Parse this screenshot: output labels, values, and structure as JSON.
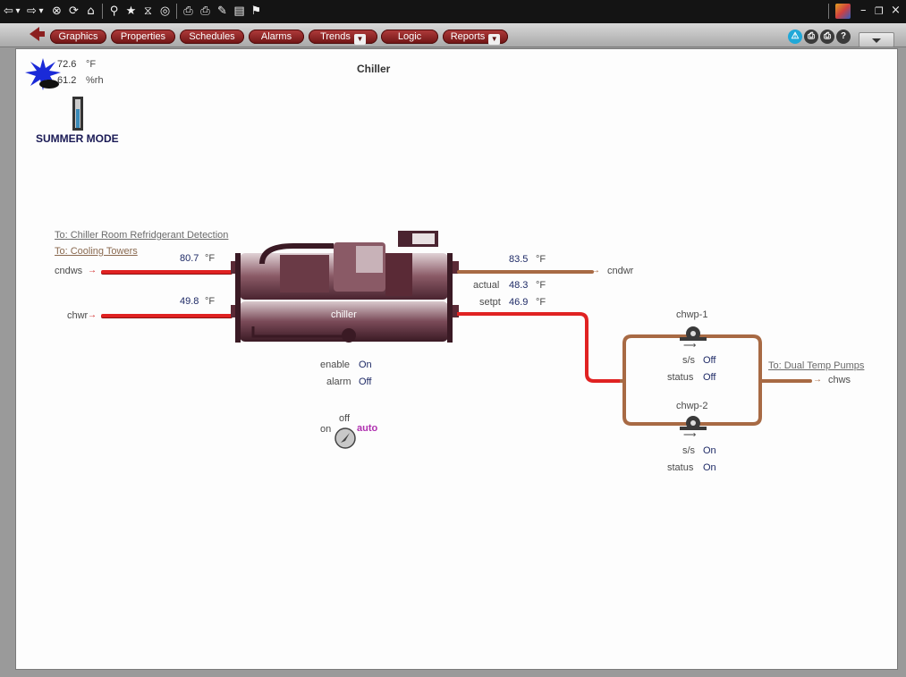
{
  "toolbar": {
    "icons": [
      "back-icon",
      "dropdown-icon",
      "forward-icon",
      "dropdown-icon",
      "stop-icon",
      "refresh-icon",
      "home-icon",
      "search-icon",
      "favorites-icon",
      "history-icon",
      "web-icon",
      "print-icon",
      "printer-icon",
      "edit-icon",
      "document-icon",
      "discuss-icon"
    ],
    "glyphs": [
      "⇦",
      "▾",
      "⇨",
      "▾",
      "⊗",
      "⟳",
      "⌂",
      "⚲",
      "★",
      "⧖",
      "◎",
      "⎙",
      "⎙",
      "✎",
      "▤",
      "⚑"
    ]
  },
  "window": {
    "minimize": "–",
    "restore": "❐",
    "close": "×"
  },
  "nav": {
    "tabs": [
      {
        "label": "Graphics",
        "dropdown": false
      },
      {
        "label": "Properties",
        "dropdown": false
      },
      {
        "label": "Schedules",
        "dropdown": false
      },
      {
        "label": "Alarms",
        "dropdown": false
      },
      {
        "label": "Trends",
        "dropdown": true
      },
      {
        "label": "Logic",
        "dropdown": false
      },
      {
        "label": "Reports",
        "dropdown": true
      }
    ],
    "right_buttons": [
      "alarm-bell-icon",
      "print-icon",
      "print-setup-icon",
      "help-icon"
    ],
    "help_glyph": "?"
  },
  "weather": {
    "temp_value": "72.6",
    "temp_unit": "°F",
    "rh_value": "61.2",
    "rh_unit": "%rh",
    "mode": "SUMMER MODE"
  },
  "page_title": "Chiller",
  "links": {
    "refrigerant": "To: Chiller Room Refridgerant Detection",
    "cooling_towers": "To: Cooling Towers",
    "dual_temp": "To: Dual Temp Pumps"
  },
  "chiller": {
    "label": "chiller",
    "cndws_label": "cndws",
    "cndws_value": "80.7",
    "cndws_unit": "°F",
    "chwr_label": "chwr",
    "chwr_value": "49.8",
    "chwr_unit": "°F",
    "cndwr_label": "cndwr",
    "cndwr_value": "83.5",
    "cndwr_unit": "°F",
    "actual_label": "actual",
    "actual_value": "48.3",
    "actual_unit": "°F",
    "setpt_label": "setpt",
    "setpt_value": "46.9",
    "setpt_unit": "°F",
    "enable_label": "enable",
    "enable_value": "On",
    "alarm_label": "alarm",
    "alarm_value": "Off"
  },
  "hoa": {
    "off": "off",
    "on": "on",
    "auto": "auto"
  },
  "pumps": [
    {
      "name": "chwp-1",
      "ss_label": "s/s",
      "ss_value": "Off",
      "status_label": "status",
      "status_value": "Off"
    },
    {
      "name": "chwp-2",
      "ss_label": "s/s",
      "ss_value": "On",
      "status_label": "status",
      "status_value": "On"
    }
  ],
  "chws_label": "chws",
  "arrow": "→",
  "colors": {
    "supply_pipe": "#e02222",
    "return_pipe": "#a86a44",
    "tab_bg": "#8c1e1e",
    "value_text": "#1e2a66",
    "auto_text": "#b030b0"
  }
}
